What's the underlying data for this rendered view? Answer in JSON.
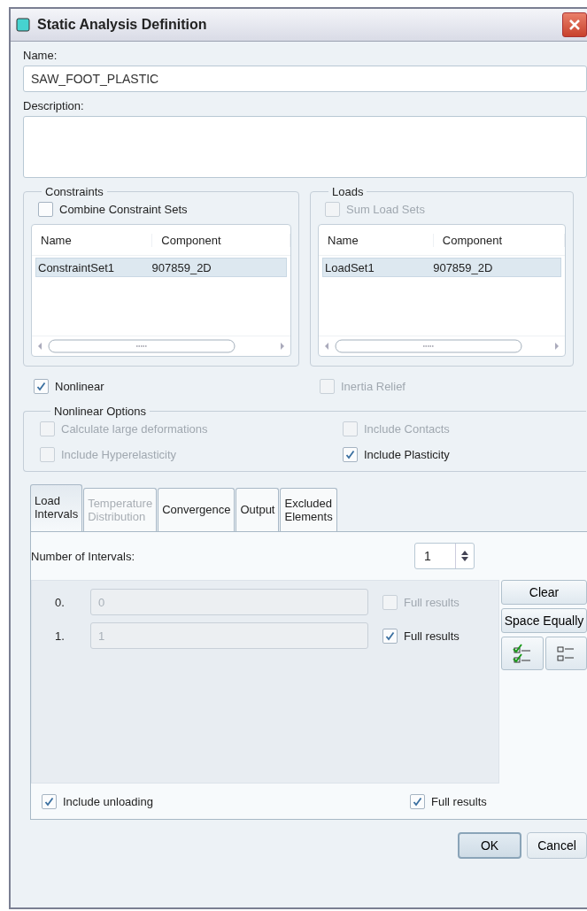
{
  "window": {
    "title": "Static Analysis Definition"
  },
  "name": {
    "label": "Name:",
    "value": "SAW_FOOT_PLASTIC"
  },
  "description": {
    "label": "Description:"
  },
  "constraints": {
    "title": "Constraints",
    "option": {
      "label": "Combine Constraint Sets",
      "checked": false,
      "disabled": false
    },
    "columns": [
      "Name",
      "Component"
    ],
    "rows": [
      {
        "cells": [
          "ConstraintSet1",
          "907859_2D"
        ],
        "selected": true
      }
    ]
  },
  "loads": {
    "title": "Loads",
    "option": {
      "label": "Sum Load Sets",
      "checked": false,
      "disabled": true
    },
    "columns": [
      "Name",
      "Component"
    ],
    "rows": [
      {
        "cells": [
          "LoadSet1",
          "907859_2D"
        ],
        "selected": true
      }
    ]
  },
  "nonlinear": {
    "label": "Nonlinear",
    "checked": true,
    "disabled": false
  },
  "inertia_relief": {
    "label": "Inertia Relief",
    "checked": false,
    "disabled": true
  },
  "nonlinear_options": {
    "title": "Nonlinear Options",
    "options": [
      {
        "label": "Calculate large deformations",
        "checked": false,
        "disabled": true
      },
      {
        "label": "Include Contacts",
        "checked": false,
        "disabled": true
      },
      {
        "label": "Include Hyperelasticity",
        "checked": false,
        "disabled": true
      },
      {
        "label": "Include Plasticity",
        "checked": true,
        "disabled": false
      }
    ]
  },
  "tabs": [
    {
      "label": "Load\nIntervals",
      "selected": true,
      "disabled": false
    },
    {
      "label": "Temperature\nDistribution",
      "selected": false,
      "disabled": true
    },
    {
      "label": "Convergence",
      "selected": false,
      "disabled": false
    },
    {
      "label": "Output",
      "selected": false,
      "disabled": false
    },
    {
      "label": "Excluded\nElements",
      "selected": false,
      "disabled": false
    }
  ],
  "intervals": {
    "label": "Number of Intervals:",
    "count": "1",
    "rows": [
      {
        "index": "0.",
        "value": "0",
        "full_results": {
          "label": "Full results",
          "checked": false,
          "disabled": true
        }
      },
      {
        "index": "1.",
        "value": "1",
        "full_results": {
          "label": "Full results",
          "checked": true,
          "disabled": false
        }
      }
    ],
    "buttons": [
      "Clear",
      "Space Equally"
    ]
  },
  "include_unloading": {
    "label": "Include unloading",
    "checked": true,
    "disabled": false
  },
  "full_results": {
    "label": "Full results",
    "checked": true,
    "disabled": false
  },
  "buttons": [
    {
      "label": "OK",
      "default": true
    },
    {
      "label": "Cancel",
      "default": false
    }
  ]
}
